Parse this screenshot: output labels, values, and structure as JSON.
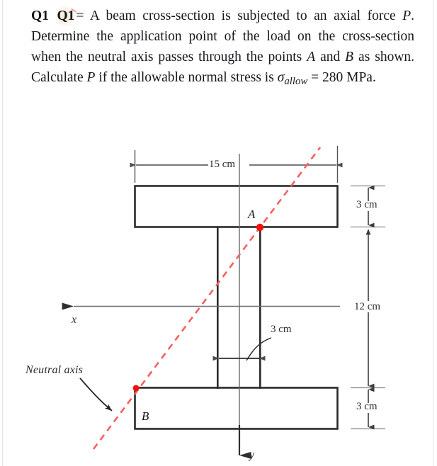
{
  "statement": {
    "q_label": "Q1",
    "q_ghost": "Q1",
    "equals": "=",
    "line_1": "A beam cross-section is subjected to an",
    "line_2_a": "axial force",
    "var_p": "P",
    "line_2_b": ". Determine the application point of the",
    "line_3": "load on the cross-section when the neutral axis passes",
    "line_4_a": "through the points",
    "var_a": "A",
    "line_4_b": "and",
    "var_b": "B",
    "line_4_c": "as shown. Calculate",
    "var_p2": "P",
    "line_4_d": "if",
    "line_5_a": "the allowable normal stress is",
    "sigma": "σ",
    "sigma_sub": "allow",
    "line_5_b": "= 280 MPa.",
    "full_text": "Q1 Q1= A beam cross-section is subjected to an axial force P. Determine the application point of the load on the cross-section when the neutral axis passes through the points A and B as shown. Calculate P if the allowable normal stress is σallow = 280 MPa."
  },
  "figure": {
    "title": "I-beam cross-section with inclined neutral axis",
    "dimensions": {
      "flange_width": "15 cm",
      "top_flange_thickness": "3 cm",
      "web_height": "12 cm",
      "bottom_flange_thickness": "3 cm",
      "web_width": "3 cm"
    },
    "points": {
      "a": "A",
      "b": "B"
    },
    "axes": {
      "x": "x",
      "y": "y"
    },
    "annotation": "Neutral axis",
    "colors": {
      "neutral_axis": "#f5605f",
      "point_marker": "#f50f0f",
      "outline": "#2a2a2a",
      "dimension": "#4d4d4d"
    }
  },
  "chart_data": {
    "type": "diagram",
    "title": "I-beam cross-section with inclined neutral axis",
    "units": "cm",
    "geometry": {
      "top_flange": {
        "width": 15,
        "thickness": 3
      },
      "bottom_flange": {
        "width": 15,
        "thickness": 3
      },
      "web": {
        "width": 3,
        "height": 12
      }
    },
    "labeled_points": [
      {
        "name": "A",
        "description": "intersection of neutral axis with bottom of top flange at right edge of web"
      },
      {
        "name": "B",
        "description": "intersection of neutral axis with top of bottom flange at left edge of bottom flange"
      }
    ],
    "neutral_axis": {
      "style": "dashed",
      "color": "#f5605f",
      "through": [
        "A",
        "B"
      ]
    },
    "axis_labels": {
      "x": "x (pointing left)",
      "y": "y (pointing down)"
    },
    "given": {
      "sigma_allow": 280,
      "sigma_allow_units": "MPa"
    }
  }
}
